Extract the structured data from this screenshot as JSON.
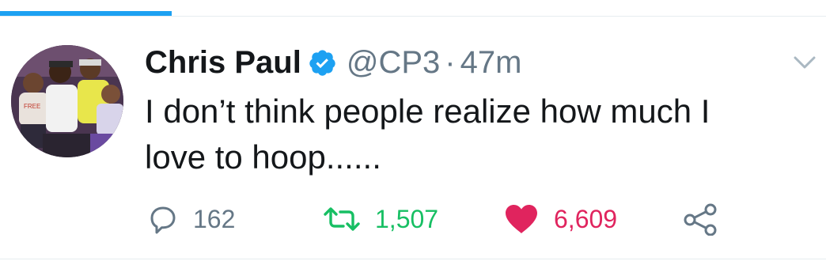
{
  "tweet": {
    "display_name": "Chris Paul",
    "handle": "@CP3",
    "separator": "·",
    "timestamp": "47m",
    "text": "I don’t think people realize how much I\nlove to hoop......",
    "verified": true
  },
  "actions": {
    "reply_count": "162",
    "retweet_count": "1,507",
    "like_count": "6,609"
  },
  "icons": {
    "avatar": "profile-photo",
    "verified": "verified-badge-icon",
    "more": "chevron-down-icon",
    "reply": "reply-icon",
    "retweet": "retweet-icon",
    "like": "heart-icon",
    "share": "share-icon"
  },
  "colors": {
    "accent": "#1da1f2",
    "text": "#14171a",
    "muted": "#657786",
    "retweet": "#17bf63",
    "like": "#e0245e",
    "divider": "#e6ecf0"
  }
}
